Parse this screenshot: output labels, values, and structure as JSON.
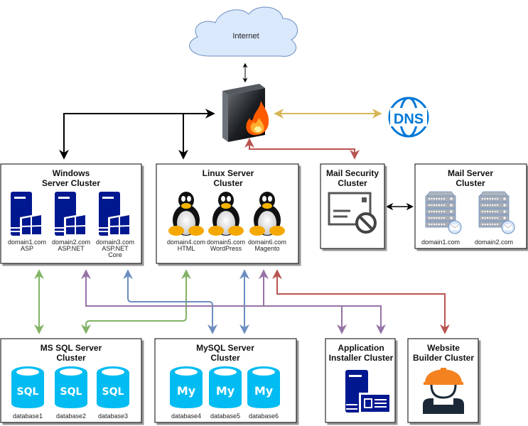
{
  "internet": {
    "label": "Internet"
  },
  "firewall": {
    "name": "firewall"
  },
  "dns": {
    "label": "DNS"
  },
  "windows": {
    "title": [
      "Windows",
      "Server Cluster"
    ],
    "servers": [
      {
        "domain": "domain1.com",
        "tech": [
          "ASP"
        ]
      },
      {
        "domain": "domain2.com",
        "tech": [
          "ASP.NET"
        ]
      },
      {
        "domain": "domain3.com",
        "tech": [
          "ASP.NET",
          "Core"
        ]
      }
    ]
  },
  "linux": {
    "title": [
      "Linux Server",
      "Cluster"
    ],
    "servers": [
      {
        "domain": "domain4.com",
        "tech": "HTML"
      },
      {
        "domain": "domain5.com",
        "tech": "WordPress"
      },
      {
        "domain": "domain6.com",
        "tech": "Magento"
      }
    ]
  },
  "mail_security": {
    "title": [
      "Mail Security",
      "Cluster"
    ]
  },
  "mail_server": {
    "title": [
      "Mail Server",
      "Cluster"
    ],
    "servers": [
      {
        "domain": "domain1.com"
      },
      {
        "domain": "domain2.com"
      }
    ]
  },
  "mssql": {
    "title": [
      "MS SQL Server",
      "Cluster"
    ],
    "icon_text": "SQL",
    "databases": [
      "database1",
      "database2",
      "database3"
    ]
  },
  "mysql": {
    "title": [
      "MySQL Server",
      "Cluster"
    ],
    "icon_text": "My",
    "databases": [
      "database4",
      "database5",
      "database6"
    ]
  },
  "app_installer": {
    "title": [
      "Application",
      "Installer Cluster"
    ]
  },
  "website_builder": {
    "title": [
      "Website",
      "Builder Cluster"
    ]
  },
  "colors": {
    "black": "#000000",
    "green": "#82b366",
    "purple": "#9673a6",
    "blue": "#6c8ebf",
    "red": "#b85450",
    "gold": "#d6b656",
    "windows_blue": "#00188f",
    "sql_cyan": "#00bcf2",
    "dns_blue": "#0078d7",
    "cloud_fill": "#dae8fc",
    "cloud_stroke": "#6c8ebf"
  }
}
